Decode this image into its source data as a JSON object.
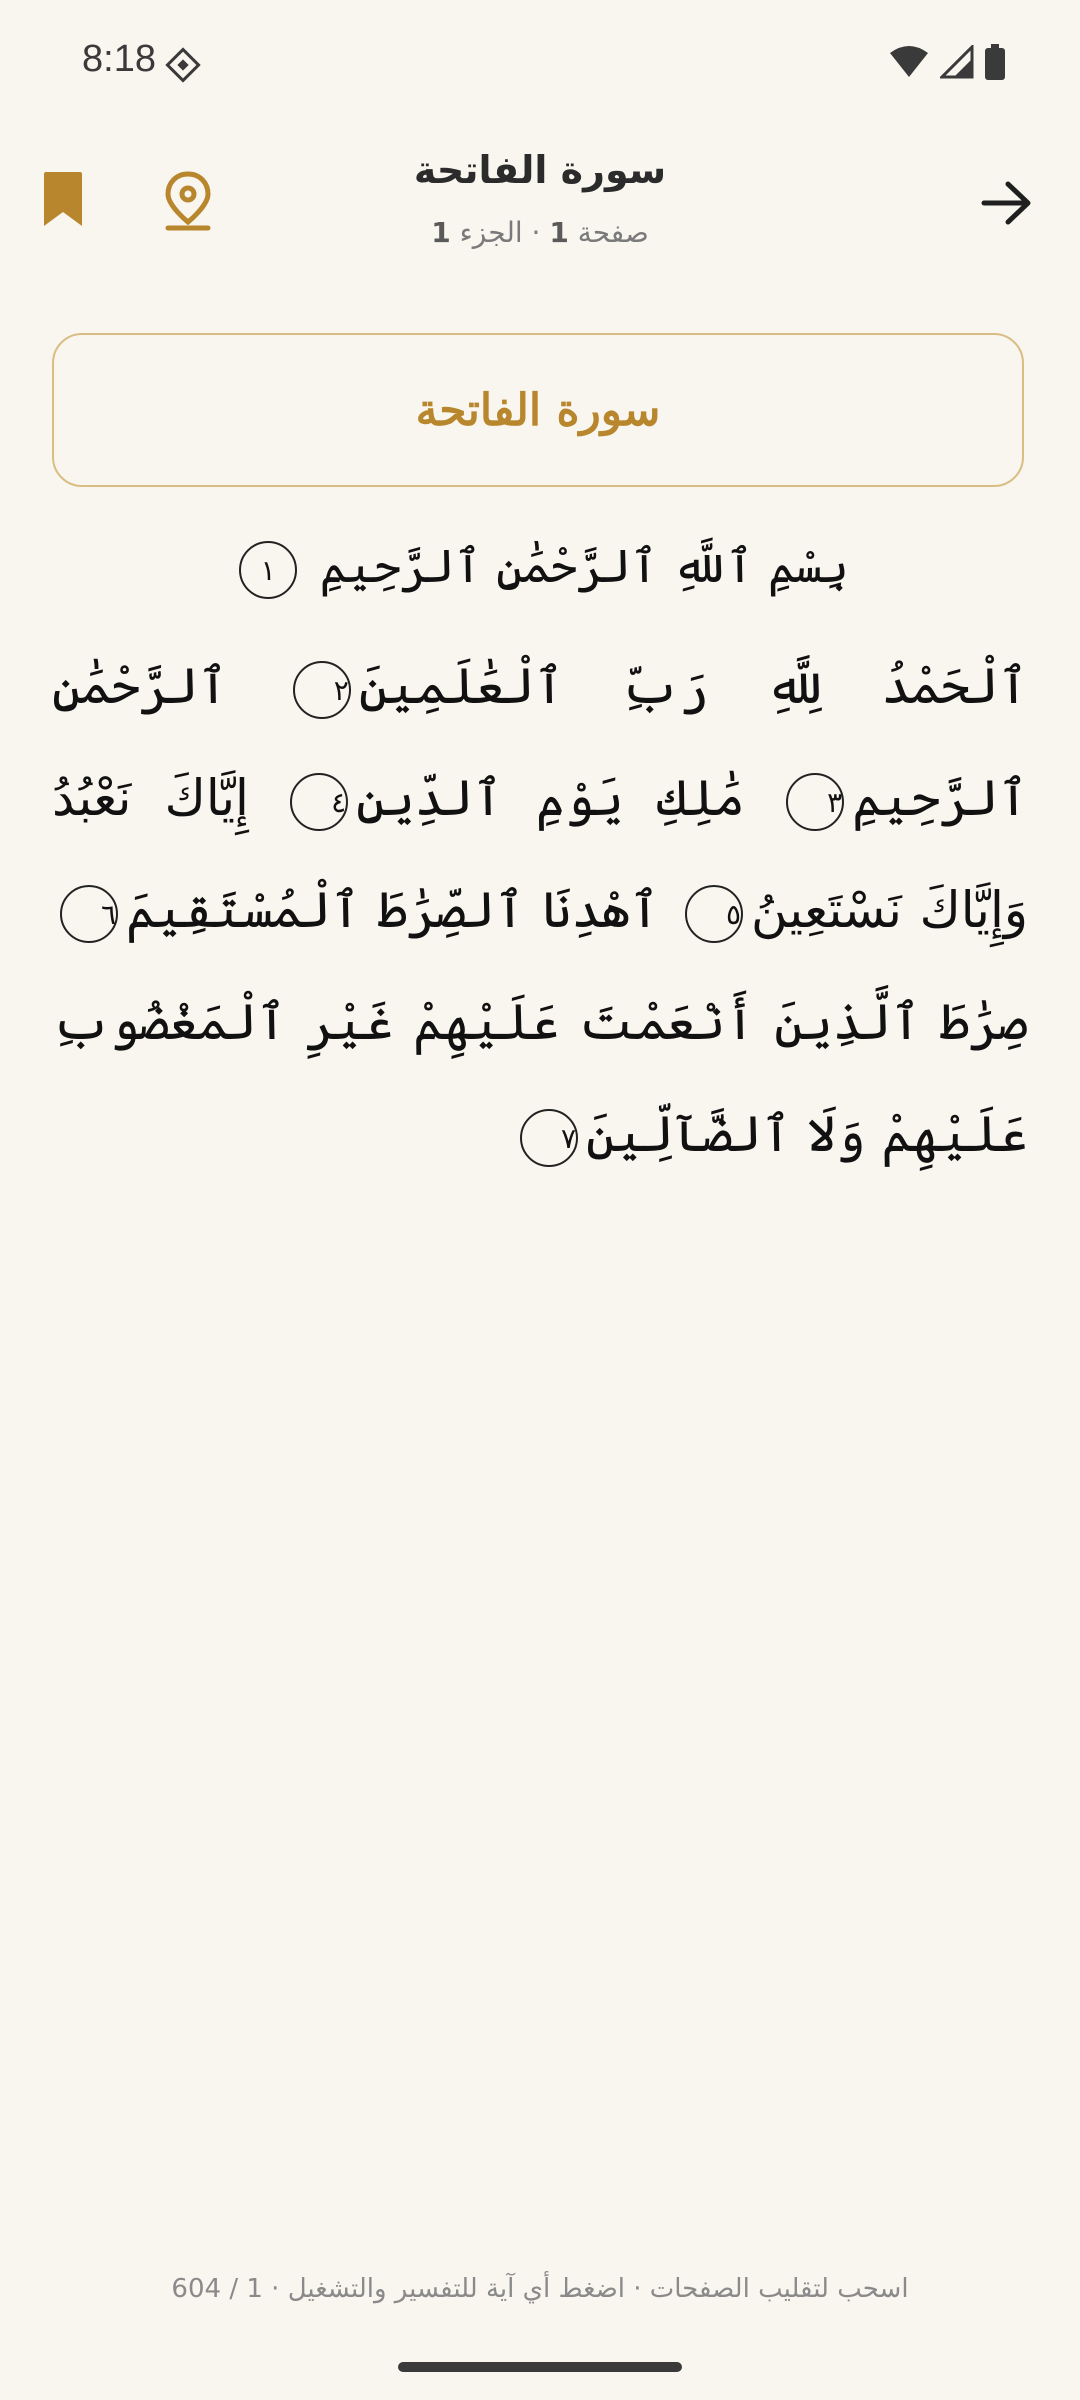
{
  "status_bar": {
    "time": "8:18"
  },
  "header": {
    "title": "سورة الفاتحة",
    "subtitle_page_label": "صفحة",
    "subtitle_page_number": "1",
    "subtitle_separator": " · ",
    "subtitle_juz_label": "الجزء",
    "subtitle_juz_number": "1"
  },
  "surah_banner": {
    "title": "سورة الفاتحة"
  },
  "basmala": {
    "text": "بِسْمِ ٱللَّهِ ٱلرَّحْمَٰنِ ٱلرَّحِيمِ",
    "marker": "١"
  },
  "ayahs": [
    {
      "text": "ٱلْحَمْدُ لِلَّهِ رَبِّ ٱلْعَٰلَمِينَ",
      "marker": "٢"
    },
    {
      "text": "ٱلرَّحْمَٰنِ ٱلرَّحِيمِ",
      "marker": "٣"
    },
    {
      "text": "مَٰلِكِ يَوْمِ ٱلدِّينِ",
      "marker": "٤"
    },
    {
      "text": "إِيَّاكَ نَعْبُدُ وَإِيَّاكَ نَسْتَعِينُ",
      "marker": "٥"
    },
    {
      "text": "ٱهْدِنَا ٱلصِّرَٰطَ ٱلْمُسْتَقِيمَ",
      "marker": "٦"
    },
    {
      "text": "صِرَٰطَ ٱلَّذِينَ أَنْعَمْتَ عَلَيْهِمْ غَيْرِ ٱلْمَغْضُوبِ عَلَيْهِمْ وَلَا ٱلضَّآلِّينَ",
      "marker": "٧"
    }
  ],
  "footer": {
    "hint": "اسحب لتقليب الصفحات · اضغط أي آية للتفسير والتشغيل · 1 / 604"
  },
  "colors": {
    "background": "#f9f5ef",
    "accent": "#b8872d",
    "banner_border": "#d9be84"
  },
  "icons": {
    "bookmark": "bookmark-icon",
    "location": "location-pin-icon",
    "back": "arrow-right-icon"
  }
}
